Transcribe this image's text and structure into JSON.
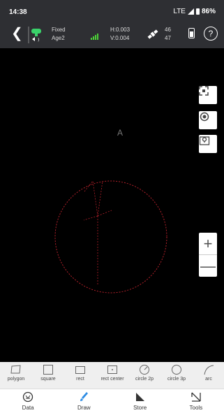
{
  "status_bar": {
    "time": "14:38",
    "network": "LTE",
    "battery": "86%"
  },
  "header": {
    "solution": "Fixed",
    "age": "Age2",
    "h_precision": "H:0.003",
    "v_precision": "V:0.004",
    "sats_top": "46",
    "sats_bottom": "47",
    "help_glyph": "?",
    "colors": {
      "background": "#2e2f33",
      "receiver": "#3ad16a",
      "signal": "#4cd137"
    }
  },
  "map": {
    "north_label": "A",
    "zoom_in": "+",
    "zoom_out": "—",
    "colors": {
      "background": "#000000",
      "circle": "#b3202a"
    }
  },
  "draw_tools": [
    {
      "label": "polygon",
      "icon": "polygon-icon"
    },
    {
      "label": "square",
      "icon": "square-icon"
    },
    {
      "label": "rect",
      "icon": "rect-icon"
    },
    {
      "label": "rect center",
      "icon": "rect-center-icon"
    },
    {
      "label": "circle 2p",
      "icon": "circle-2p-icon"
    },
    {
      "label": "circle 3p",
      "icon": "circle-3p-icon"
    },
    {
      "label": "arc",
      "icon": "arc-icon"
    }
  ],
  "bottom_nav": [
    {
      "label": "Data",
      "icon": "data-icon"
    },
    {
      "label": "Draw",
      "icon": "brush-icon",
      "active": true
    },
    {
      "label": "Store",
      "icon": "store-icon"
    },
    {
      "label": "Tools",
      "icon": "tools-icon"
    }
  ]
}
